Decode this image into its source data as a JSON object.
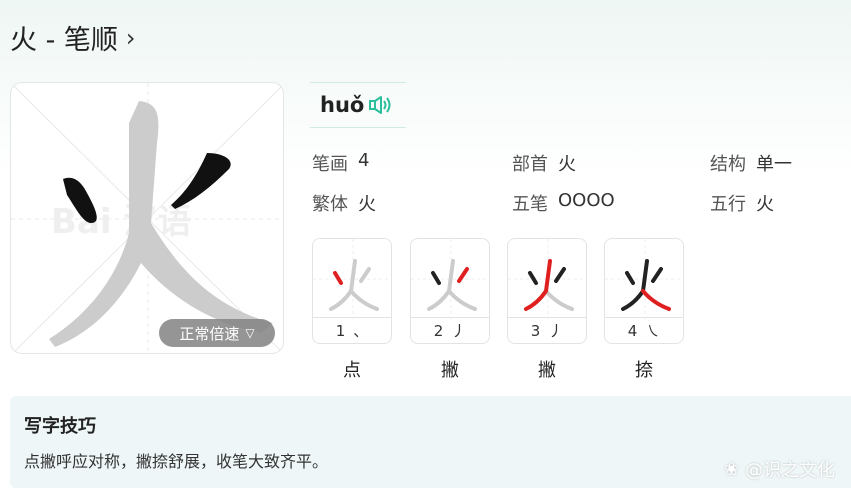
{
  "header": {
    "title": "火 - 笔顺"
  },
  "character": {
    "glyph": "火",
    "watermark_text": "Bai 汉语"
  },
  "speed_button": {
    "label": "正常倍速"
  },
  "pinyin": {
    "text": "huǒ"
  },
  "info": {
    "strokes_label": "笔画",
    "strokes_value": "4",
    "radical_label": "部首",
    "radical_value": "火",
    "structure_label": "结构",
    "structure_value": "单一",
    "traditional_label": "繁体",
    "traditional_value": "火",
    "wubi_label": "五笔",
    "wubi_value": "OOOO",
    "wuxing_label": "五行",
    "wuxing_value": "火"
  },
  "strokes": [
    {
      "index": "1",
      "symbol": "、",
      "name": "点"
    },
    {
      "index": "2",
      "symbol": "丿",
      "name": "撇"
    },
    {
      "index": "3",
      "symbol": "丿",
      "name": "撇"
    },
    {
      "index": "4",
      "symbol": "㇏",
      "name": "捺"
    }
  ],
  "tips": {
    "title": "写字技巧",
    "text": "点撇呼应对称，撇捺舒展，收笔大致齐平。"
  },
  "source_watermark": "@识之文化",
  "colors": {
    "accent": "#2bbf9c",
    "highlight_stroke": "#e02020",
    "done_stroke": "#222222",
    "pending_stroke": "#cccccc"
  }
}
